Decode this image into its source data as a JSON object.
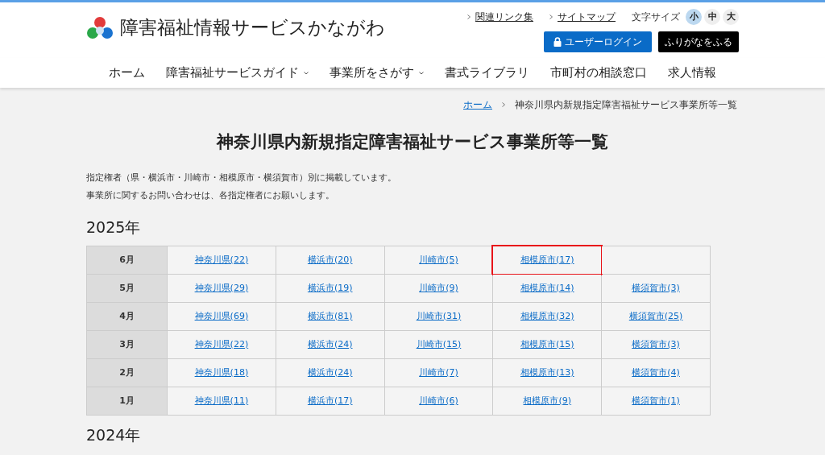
{
  "site": {
    "title": "障害福祉情報サービスかながわ"
  },
  "utility_links": [
    {
      "label": "関連リンク集"
    },
    {
      "label": "サイトマップ"
    }
  ],
  "font_size": {
    "label": "文字サイズ",
    "options": [
      {
        "label": "小",
        "selected": true
      },
      {
        "label": "中",
        "selected": false
      },
      {
        "label": "大",
        "selected": false
      }
    ]
  },
  "login_button": "ユーザーログイン",
  "furigana_button": "ふりがなをふる",
  "nav": [
    {
      "label": "ホーム",
      "dropdown": false
    },
    {
      "label": "障害福祉サービスガイド",
      "dropdown": true
    },
    {
      "label": "事業所をさがす",
      "dropdown": true
    },
    {
      "label": "書式ライブラリ",
      "dropdown": false
    },
    {
      "label": "市町村の相談窓口",
      "dropdown": false
    },
    {
      "label": "求人情報",
      "dropdown": false
    }
  ],
  "breadcrumb": [
    {
      "label": "ホーム",
      "link": true
    },
    {
      "label": "神奈川県内新規指定障害福祉サービス事業所等一覧",
      "link": false
    }
  ],
  "heading": "神奈川県内新規指定障害福祉サービス事業所等一覧",
  "intro": [
    "指定権者（県・横浜市・川崎市・相模原市・横須賀市）別に掲載しています。",
    "事業所に関するお問い合わせは、各指定権者にお願いします。"
  ],
  "years": [
    {
      "year": "2025年",
      "rows": [
        {
          "month": "6月",
          "cells": [
            {
              "text": "神奈川県(22)",
              "highlighted": false
            },
            {
              "text": "横浜市(20)",
              "highlighted": false
            },
            {
              "text": "川崎市(5)",
              "highlighted": false
            },
            {
              "text": "相模原市(17)",
              "highlighted": true
            },
            {
              "text": "",
              "highlighted": false
            }
          ]
        },
        {
          "month": "5月",
          "cells": [
            {
              "text": "神奈川県(29)",
              "highlighted": false
            },
            {
              "text": "横浜市(19)",
              "highlighted": false
            },
            {
              "text": "川崎市(9)",
              "highlighted": false
            },
            {
              "text": "相模原市(14)",
              "highlighted": false
            },
            {
              "text": "横須賀市(3)",
              "highlighted": false
            }
          ]
        },
        {
          "month": "4月",
          "cells": [
            {
              "text": "神奈川県(69)",
              "highlighted": false
            },
            {
              "text": "横浜市(81)",
              "highlighted": false
            },
            {
              "text": "川崎市(31)",
              "highlighted": false
            },
            {
              "text": "相模原市(32)",
              "highlighted": false
            },
            {
              "text": "横須賀市(25)",
              "highlighted": false
            }
          ]
        },
        {
          "month": "3月",
          "cells": [
            {
              "text": "神奈川県(22)",
              "highlighted": false
            },
            {
              "text": "横浜市(24)",
              "highlighted": false
            },
            {
              "text": "川崎市(15)",
              "highlighted": false
            },
            {
              "text": "相模原市(15)",
              "highlighted": false
            },
            {
              "text": "横須賀市(3)",
              "highlighted": false
            }
          ]
        },
        {
          "month": "2月",
          "cells": [
            {
              "text": "神奈川県(18)",
              "highlighted": false
            },
            {
              "text": "横浜市(24)",
              "highlighted": false
            },
            {
              "text": "川崎市(7)",
              "highlighted": false
            },
            {
              "text": "相模原市(13)",
              "highlighted": false
            },
            {
              "text": "横須賀市(4)",
              "highlighted": false
            }
          ]
        },
        {
          "month": "1月",
          "cells": [
            {
              "text": "神奈川県(11)",
              "highlighted": false
            },
            {
              "text": "横浜市(17)",
              "highlighted": false
            },
            {
              "text": "川崎市(6)",
              "highlighted": false
            },
            {
              "text": "相模原市(9)",
              "highlighted": false
            },
            {
              "text": "横須賀市(1)",
              "highlighted": false
            }
          ]
        }
      ]
    },
    {
      "year": "2024年"
    }
  ]
}
